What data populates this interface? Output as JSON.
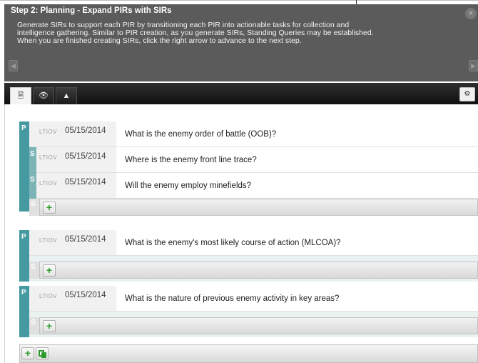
{
  "instructions": {
    "title": "Step 2: Planning - Expand PIRs with SIRs",
    "line1": "Generate SIRs to support each PIR by transitioning each PIR into actionable tasks for collection and",
    "line2": "intelligence gathering. Similar to PIR creation, as you generate SIRs, Standing Queries may be established.",
    "line3": "When you are finished creating SIRs, click the right arrow to advance to the next step.",
    "close_icon": "×",
    "prev_icon": "◀",
    "next_icon": "▶"
  },
  "tabs": [
    {
      "icon": "document-icon",
      "glyph": "🗎",
      "active": true
    },
    {
      "icon": "eye-icon",
      "glyph": "👁",
      "active": false
    },
    {
      "icon": "user-icon",
      "glyph": "▲",
      "active": false
    }
  ],
  "settings_glyph": "⚙",
  "labels": {
    "pir_letter": "P",
    "sir_letter": "S",
    "ltiov": "LTIOV",
    "add": "+"
  },
  "pirs": [
    {
      "date": "05/15/2014",
      "question": "What is the enemy order of battle (OOB)?",
      "sirs": [
        {
          "date": "05/15/2014",
          "question": "Where is the enemy front line trace?"
        },
        {
          "date": "05/15/2014",
          "question": "Will the enemy employ minefields?"
        }
      ]
    },
    {
      "date": "05/15/2014",
      "question": "What is the enemy's most likely course of action (MLCOA)?",
      "sirs": []
    },
    {
      "date": "05/15/2014",
      "question": "What is the nature of previous enemy activity in key areas?",
      "sirs": []
    }
  ],
  "colors": {
    "pir_bar": "#449aa0",
    "sir_bar": "#7bb3b6",
    "add_green": "#2e9a2e",
    "header_bg": "#5b5b5b"
  }
}
